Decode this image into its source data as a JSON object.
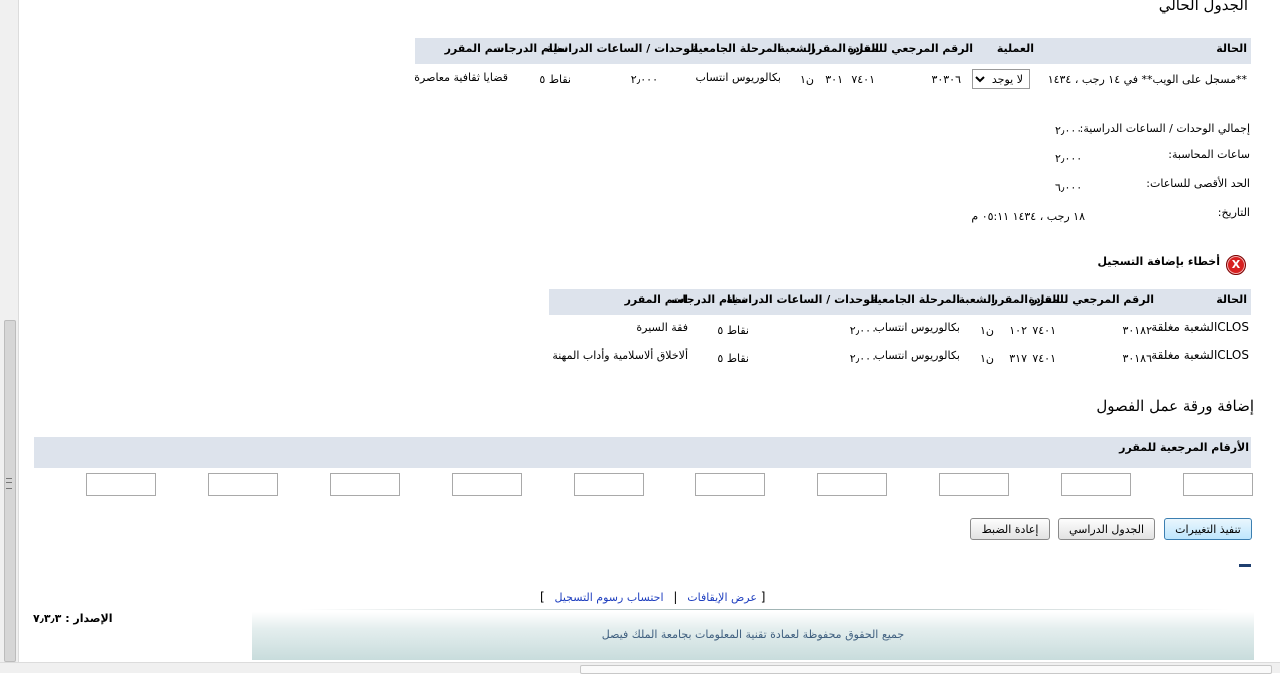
{
  "current_schedule": {
    "title": "الجدول الحالي",
    "headers": [
      "الحالة",
      "العملية",
      "الرقم المرجعي للمقرر",
      "المادة",
      "المقرر",
      "الشعبة",
      "المرحلة الجامعية",
      "الوحدات / الساعات الدراسية",
      "نظام الدرجات",
      "اسم المقرر"
    ],
    "row": {
      "status": "**مسجل على الويب** في ١٤ رجب ، ١٤٣٤",
      "action_value": "لا يوجد",
      "crn": "٣٠٣٠٦",
      "subject": "٧٤٠١",
      "course": "٣٠١",
      "section": "ن١",
      "level": "بكالوريوس انتساب",
      "units": "٢٫٠٠٠",
      "grade_mode": "نقاط ٥",
      "title": "قضايا ثقافية معاصرة"
    }
  },
  "summary": {
    "total_units_label": "إجمالي الوحدات / الساعات الدراسية:",
    "total_units_value": "٢٫٠٠٠",
    "billing_label": "ساعات المحاسبة:",
    "billing_value": "٢٫٠٠٠",
    "max_label": "الحد الأقصى للساعات:",
    "max_value": "٦٫٠٠٠",
    "date_label": "التاريخ:",
    "date_value": "١٨ رجب ، ١٤٣٤ ٠٥:١١ م"
  },
  "errors": {
    "icon_glyph": "X",
    "title": "أخطاء بإضافة التسجيل",
    "headers": [
      "الحالة",
      "الرقم المرجعي للمقرر",
      "المادة",
      "المقرر",
      "الشعبة",
      "المرحلة الجامعية",
      "الوحدات / الساعات الدراسية",
      "نظام الدرجات",
      "اسم المقرر"
    ],
    "rows": [
      {
        "status": "CLOSالشعبة مغلقة",
        "crn": "٣٠١٨٢",
        "subject": "٧٤٠١",
        "course": "١٠٢",
        "section": "ن١",
        "level": "بكالوريوس انتساب",
        "units": "٢٫٠٠٠",
        "grade_mode": "نقاط ٥",
        "title": "فقة السيرة"
      },
      {
        "status": "CLOSالشعبة مغلقة",
        "crn": "٣٠١٨٦",
        "subject": "٧٤٠١",
        "course": "٣١٧",
        "section": "ن١",
        "level": "بكالوريوس انتساب",
        "units": "٢٫٠٠٠",
        "grade_mode": "نقاط ٥",
        "title": "ألاخلاق ألاسلامية وأداب المهنة"
      }
    ]
  },
  "add_worksheet": {
    "title": "إضافة ورقة عمل الفصول",
    "crn_header": "الأرقام المرجعية للمقرر"
  },
  "buttons": {
    "submit": "تنفيذ التغييرات",
    "schedule": "الجدول الدراسي",
    "reset": "إعادة الضبط"
  },
  "links": {
    "bracket_open": "[",
    "holds": "عرض الإيقافات",
    "separator": "|",
    "fees": "احتساب رسوم التسجيل",
    "bracket_close": "]"
  },
  "footer": {
    "release_label": "الإصدار :",
    "release_value": "٧٫٣٫٣",
    "copyright": "جميع الحقوق محفوظة لعمادة تقنية المعلومات بجامعة الملك فيصل"
  },
  "colors": {
    "header_bg": "#dde3ec",
    "link": "#1f3fbf",
    "error_icon": "#d82020",
    "footer_bg": "#c8dcdc"
  }
}
